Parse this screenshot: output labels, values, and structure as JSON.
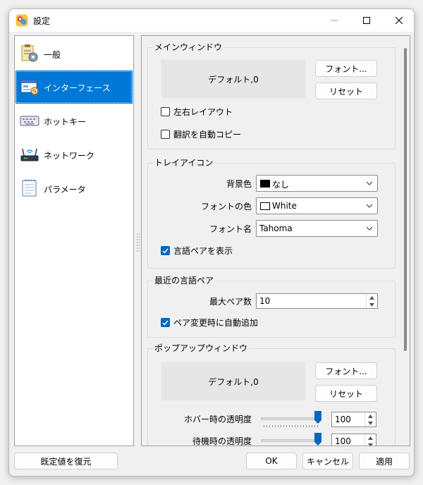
{
  "window": {
    "title": "設定"
  },
  "sidebar": {
    "items": [
      {
        "label": "一般",
        "icon": "checklist-gear-icon",
        "selected": false
      },
      {
        "label": "インターフェース",
        "icon": "window-palette-icon",
        "selected": true
      },
      {
        "label": "ホットキー",
        "icon": "keyboard-icon",
        "selected": false
      },
      {
        "label": "ネットワーク",
        "icon": "router-icon",
        "selected": false
      },
      {
        "label": "パラメータ",
        "icon": "notepad-icon",
        "selected": false
      }
    ]
  },
  "main_window": {
    "title": "メインウィンドウ",
    "preview": "デフォルト,0",
    "font_button": "フォント...",
    "reset_button": "リセット",
    "rtl_layout": {
      "label": "左右レイアウト",
      "checked": false
    },
    "auto_copy": {
      "label": "翻訳を自動コピー",
      "checked": false
    }
  },
  "tray_icon": {
    "title": "トレイアイコン",
    "bg_color_label": "背景色",
    "bg_color_value": "なし",
    "bg_swatch": "#000000",
    "font_color_label": "フォントの色",
    "font_color_value": "White",
    "font_swatch": "#ffffff",
    "font_name_label": "フォント名",
    "font_name_value": "Tahoma",
    "show_pair": {
      "label": "言語ペアを表示",
      "checked": true
    }
  },
  "recent_pairs": {
    "title": "最近の言語ペア",
    "max_label": "最大ペア数",
    "max_value": "10",
    "auto_add": {
      "label": "ペア変更時に自動追加",
      "checked": true
    }
  },
  "popup_window": {
    "title": "ポップアップウィンドウ",
    "preview": "デフォルト,0",
    "font_button": "フォント...",
    "reset_button": "リセット",
    "hover_opacity_label": "ホバー時の透明度",
    "hover_opacity_value": "100",
    "hover_opacity_fraction": 1.0,
    "idle_opacity_label": "待機時の透明度",
    "idle_opacity_value": "100",
    "idle_opacity_fraction": 1.0
  },
  "footer": {
    "restore_defaults": "既定値を復元",
    "ok": "OK",
    "cancel": "キャンセル",
    "apply": "適用"
  },
  "colors": {
    "accent": "#0078d7",
    "check": "#0067c0"
  }
}
